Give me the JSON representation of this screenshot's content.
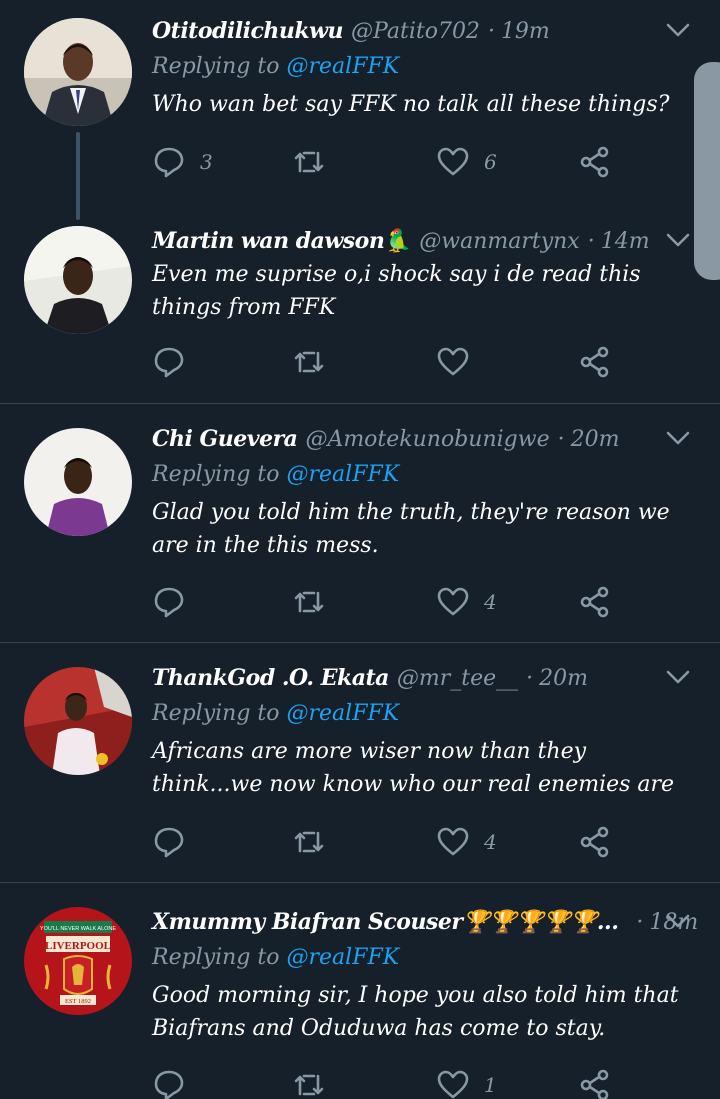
{
  "reply_prefix": "Replying to",
  "tweets": [
    {
      "name": "Otitodilichukwu",
      "handle": "@Patito702",
      "time": "19m",
      "reply_to": "@realFFK",
      "text": "Who wan bet say FFK no talk all these things?",
      "replies": "3",
      "retweets": "",
      "likes": "6"
    },
    {
      "name": "Martin wan dawson🦜",
      "handle": "@wanmartynx",
      "time": "14m",
      "reply_to": "",
      "text": "Even me suprise o,i shock say i de read this things from FFK",
      "replies": "",
      "retweets": "",
      "likes": ""
    },
    {
      "name": "Chi Guevera",
      "handle": "@Amotekunobunigwe",
      "time": "20m",
      "reply_to": "@realFFK",
      "text": "Glad you told him the truth, they're reason we are in the this mess.",
      "replies": "",
      "retweets": "",
      "likes": "4"
    },
    {
      "name": "ThankGod .O. Ekata",
      "handle": "@mr_tee__",
      "time": "20m",
      "reply_to": "@realFFK",
      "text": "Africans are more wiser now than they think...we now know who our real enemies are",
      "replies": "",
      "retweets": "",
      "likes": "4"
    },
    {
      "name": "Xmummy Biafran Scouser🏆🏆🏆🏆🏆...",
      "handle": "",
      "time": "18m",
      "reply_to": "@realFFK",
      "text": "Good morning sir, I hope you also told him that Biafrans and Oduduwa has come to stay.",
      "replies": "",
      "retweets": "",
      "likes": "1",
      "avatar_text_top": "YOU'LL NEVER WALK ALONE",
      "avatar_text_main": "LIVERPOOL",
      "avatar_text_est": "EST 1892"
    }
  ],
  "colors": {
    "background": "#15202b",
    "muted": "#8899a6",
    "mention": "#1da1f2",
    "divider": "#38444d"
  }
}
